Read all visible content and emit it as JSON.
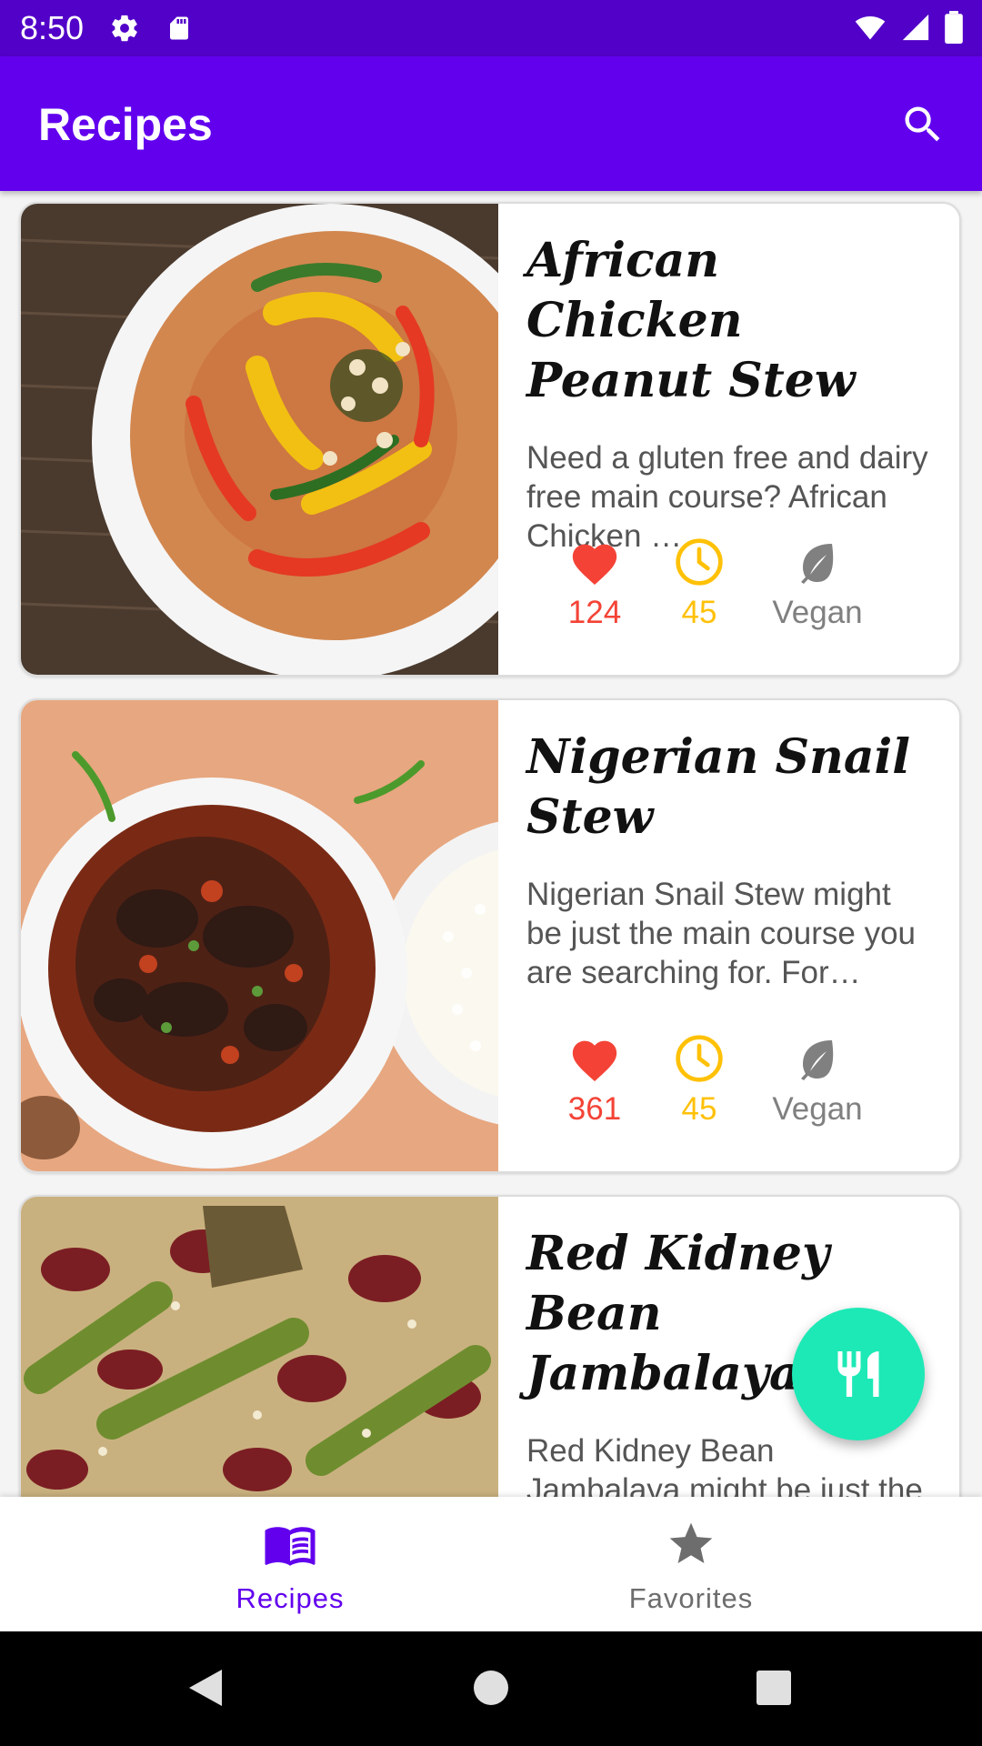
{
  "status_bar": {
    "time": "8:50"
  },
  "app_bar": {
    "title": "Recipes"
  },
  "recipes": [
    {
      "title": "African Chicken Peanut Stew",
      "description": "Need a gluten free and dairy free main course? African Chicken …",
      "likes": "124",
      "minutes": "45",
      "diet": "Vegan"
    },
    {
      "title": "Nigerian Snail Stew",
      "description": "Nigerian Snail Stew might be just the main course you are searching for. For…",
      "likes": "361",
      "minutes": "45",
      "diet": "Vegan"
    },
    {
      "title": "Red Kidney Bean Jambalaya",
      "description": "Red Kidney Bean Jambalaya might be just the Creole recipe you are …",
      "likes": "",
      "minutes": "",
      "diet": ""
    }
  ],
  "bottom_nav": {
    "items": [
      {
        "label": "Recipes",
        "icon": "book-open-icon",
        "selected": true
      },
      {
        "label": "Favorites",
        "icon": "star-icon",
        "selected": false
      }
    ]
  },
  "colors": {
    "primary": "#6200ee",
    "status_bar": "#5201c8",
    "fab": "#1de9b6",
    "likes": "#f44336",
    "time": "#ffc107",
    "vegan": "#808080"
  }
}
